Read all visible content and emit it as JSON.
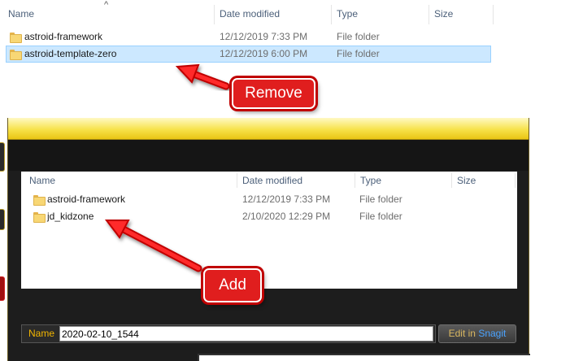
{
  "explorer_top": {
    "columns": {
      "name": "Name",
      "date_modified": "Date modified",
      "type": "Type",
      "size": "Size"
    },
    "rows": [
      {
        "name": "astroid-framework",
        "date": "12/12/2019 7:33 PM",
        "type": "File folder"
      },
      {
        "name": "astroid-template-zero",
        "date": "12/12/2019 6:00 PM",
        "type": "File folder",
        "selected": true
      }
    ]
  },
  "callouts": {
    "remove": "Remove",
    "add": "Add"
  },
  "snagit_dialog": {
    "columns": {
      "name": "Name",
      "date_modified": "Date modified",
      "type": "Type",
      "size": "Size"
    },
    "rows": [
      {
        "name": "astroid-framework",
        "date": "12/12/2019 7:33 PM",
        "type": "File folder"
      },
      {
        "name": "jd_kidzone",
        "date": "2/10/2020 12:29 PM",
        "type": "File folder"
      }
    ],
    "name_label": "Name",
    "name_value": "2020-02-10_1544",
    "edit_button": {
      "prefix": "Edit in",
      "brand": "Snagit"
    }
  },
  "colors": {
    "callout_red": "#e01e1e",
    "selection_blue": "#cce8ff",
    "title_yellow": "#f7e24a",
    "snagit_blue": "#4aa3ff"
  }
}
